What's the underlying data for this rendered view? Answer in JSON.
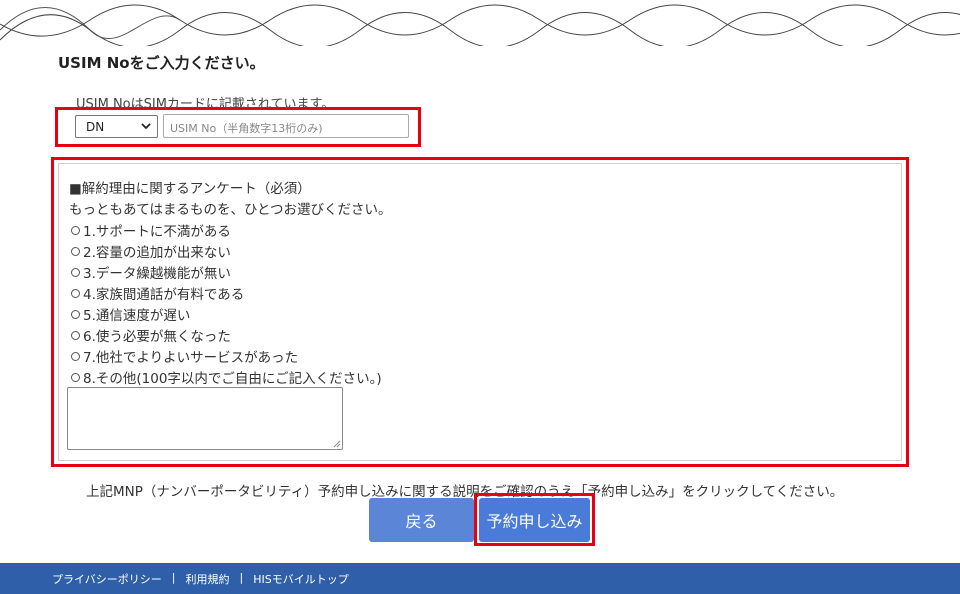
{
  "heading": "USIM Noをご入力ください。",
  "usim": {
    "note": "USIM NoはSIMカードに記載されています。",
    "prefix_select": "DN",
    "input_placeholder": "USIM No（半角数字13桁のみ)"
  },
  "survey": {
    "title": "■解約理由に関するアンケート（必須）",
    "subtitle": "もっともあてはまるものを、ひとつお選びください。",
    "options": [
      "1.サポートに不満がある",
      "2.容量の追加が出来ない",
      "3.データ繰越機能が無い",
      "4.家族間通話が有料である",
      "5.通信速度が遅い",
      "6.使う必要が無くなった",
      "7.他社でよりよいサービスがあった",
      "8.その他(100字以内でご自由にご記入ください。)"
    ]
  },
  "notice": "上記MNP（ナンバーポータビリティ）予約申し込みに関する説明をご確認のうえ「予約申し込み」をクリックしてください。",
  "buttons": {
    "back": "戻る",
    "submit": "予約申し込み"
  },
  "footer": {
    "links": [
      "プライバシーポリシー",
      "利用規約",
      "HISモバイルトップ"
    ],
    "separator": "|"
  },
  "colors": {
    "highlight": "#e60012",
    "button_blue": "#4a7bd8",
    "footer_bg": "#2f5fa8"
  }
}
